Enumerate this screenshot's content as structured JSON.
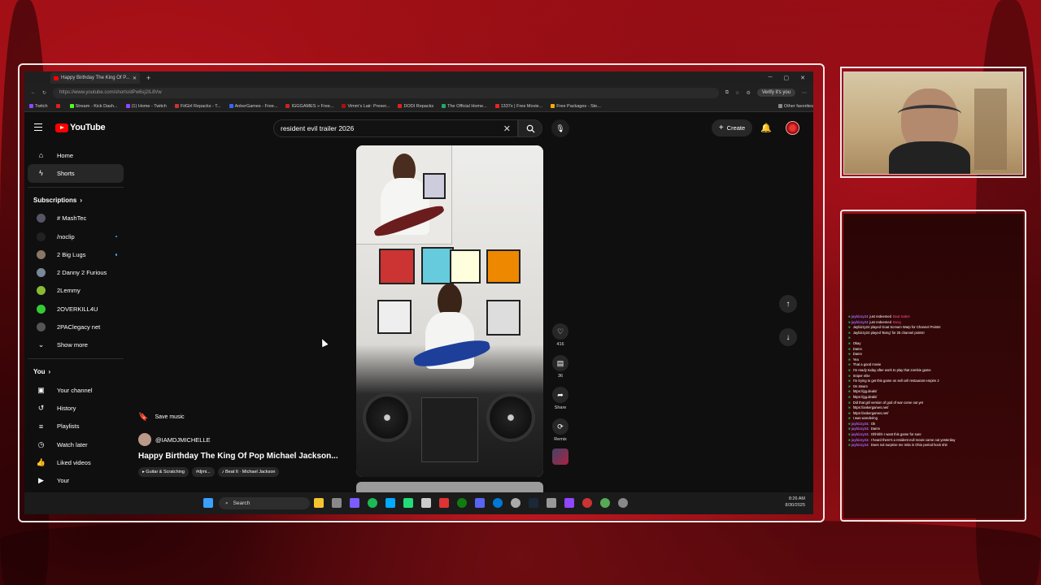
{
  "browser": {
    "tab_title": "Happy Birthday The King Of P...",
    "url": "https://www.youtube.com/shorts/dPw6sj2IL8Vw",
    "verify_label": "Verify it's you",
    "bookmarks": [
      {
        "label": "Twitch",
        "color": "#9146ff"
      },
      {
        "label": "",
        "color": "#e01f1f"
      },
      {
        "label": "Stream - Kick Dash...",
        "color": "#53fc18"
      },
      {
        "label": "(1) Home - Twitch",
        "color": "#9146ff"
      },
      {
        "label": "FitGirl Repacks - T...",
        "color": "#c33"
      },
      {
        "label": "AnkerGames - Free...",
        "color": "#36f"
      },
      {
        "label": "IGGGAMES » Free...",
        "color": "#c22"
      },
      {
        "label": "Vimm's Lair: Preser...",
        "color": "#a11"
      },
      {
        "label": "DODI Repacks",
        "color": "#d22"
      },
      {
        "label": "The Official Home...",
        "color": "#2a6"
      },
      {
        "label": "1337x | Free Movie...",
        "color": "#e22"
      },
      {
        "label": "Free Packages - Ste...",
        "color": "#fa0"
      },
      {
        "label": "Other favorites",
        "color": "#888"
      }
    ]
  },
  "youtube": {
    "logo_text": "YouTube",
    "search_value": "resident evil trailer 2026",
    "create_label": "Create",
    "sidebar": {
      "home": "Home",
      "shorts": "Shorts",
      "subscriptions_header": "Subscriptions",
      "subscriptions": [
        {
          "label": "# MashTec",
          "color": "#556",
          "dot": false
        },
        {
          "label": "/noclip",
          "color": "#222",
          "dot": true
        },
        {
          "label": "2 Big Lugs",
          "color": "#876",
          "dot": true
        },
        {
          "label": "2 Danny 2 Furious",
          "color": "#789",
          "dot": false
        },
        {
          "label": "2Lemmy",
          "color": "#8b3",
          "dot": false
        },
        {
          "label": "2OVERKILL4U",
          "color": "#3c3",
          "dot": false
        },
        {
          "label": "2PAClegacy net",
          "color": "#555",
          "dot": false
        }
      ],
      "show_more": "Show more",
      "you_header": "You",
      "you_items": [
        "Your channel",
        "History",
        "Playlists",
        "Watch later",
        "Liked videos",
        "Your"
      ]
    },
    "short": {
      "save_music": "Save music",
      "channel": "@IAMDJMICHELLE",
      "title": "Happy Birthday The King Of Pop Michael Jackson...",
      "tags": [
        "Guitar & Scratching",
        "#djmi...",
        "Beat It · Michael Jackson"
      ],
      "likes": "416",
      "comments": "36",
      "share_label": "Share",
      "remix_label": "Remix"
    }
  },
  "taskbar": {
    "search_placeholder": "Search",
    "time": "8:26 AM",
    "date": "8/30/2025"
  },
  "chat": {
    "lines": [
      {
        "user": "jaybizzy24",
        "text": "just redeemed",
        "ucolor": "#9b6bff",
        "tcolor": "#ff4fa0",
        "extra": "Beat Saber"
      },
      {
        "user": "jaybizzy24",
        "text": "just redeemed",
        "ucolor": "#9b6bff",
        "tcolor": "#ff4fa0",
        "extra": "Bong"
      },
      {
        "user": "",
        "text": "Jaybizzy24 played Goat Scream Warp for Channel Points!",
        "ucolor": "#9b6bff",
        "tcolor": "#fff",
        "extra": ""
      },
      {
        "user": "",
        "text": "Jaybizzy24 played 'Bong' for 25 channel points!",
        "ucolor": "#9b6bff",
        "tcolor": "#fff",
        "extra": ""
      },
      {
        "user": "",
        "text": "",
        "ucolor": "#9b6bff",
        "tcolor": "#fff",
        "extra": ""
      },
      {
        "user": "",
        "text": "Okay",
        "ucolor": "#9b6bff",
        "tcolor": "#fff",
        "extra": ""
      },
      {
        "user": "",
        "text": "Damn",
        "ucolor": "#9b6bff",
        "tcolor": "#fff",
        "extra": ""
      },
      {
        "user": "",
        "text": "Damn",
        "ucolor": "#9b6bff",
        "tcolor": "#fff",
        "extra": ""
      },
      {
        "user": "",
        "text": "Yea",
        "ucolor": "#9b6bff",
        "tcolor": "#fff",
        "extra": ""
      },
      {
        "user": "",
        "text": "That a good movie",
        "ucolor": "#9b6bff",
        "tcolor": "#fff",
        "extra": ""
      },
      {
        "user": "",
        "text": "I'm ready today after work to play that zombie game",
        "ucolor": "#9b6bff",
        "tcolor": "#fff",
        "extra": ""
      },
      {
        "user": "",
        "text": "Sniper elite",
        "ucolor": "#9b6bff",
        "tcolor": "#fff",
        "extra": ""
      },
      {
        "user": "",
        "text": "I'm trying to get this game on sell cell restaurant empire 2",
        "ucolor": "#9b6bff",
        "tcolor": "#fff",
        "extra": ""
      },
      {
        "user": "",
        "text": "On steam",
        "ucolor": "#9b6bff",
        "tcolor": "#fff",
        "extra": ""
      },
      {
        "user": "",
        "text": "https://gg.deals/",
        "ucolor": "#9b6bff",
        "tcolor": "#fff",
        "extra": ""
      },
      {
        "user": "",
        "text": "https://gg.deals/",
        "ucolor": "#9b6bff",
        "tcolor": "#fff",
        "extra": ""
      },
      {
        "user": "",
        "text": "Did that girl version of god of war come out yet",
        "ucolor": "#9b6bff",
        "tcolor": "#fff",
        "extra": ""
      },
      {
        "user": "",
        "text": "https://ankergames.net/",
        "ucolor": "#9b6bff",
        "tcolor": "#fff",
        "extra": ""
      },
      {
        "user": "",
        "text": "https://ankergames.net/",
        "ucolor": "#9b6bff",
        "tcolor": "#fff",
        "extra": ""
      },
      {
        "user": "",
        "text": "I was wondering",
        "ucolor": "#9b6bff",
        "tcolor": "#fff",
        "extra": ""
      },
      {
        "user": "jaybizzy24:",
        "text": "Ok",
        "ucolor": "#9b6bff",
        "tcolor": "#fff",
        "extra": ""
      },
      {
        "user": "jaybizzy24:",
        "text": "Damn",
        "ucolor": "#9b6bff",
        "tcolor": "#fff",
        "extra": ""
      },
      {
        "user": "jaybizzy24:",
        "text": "Ohhhhh I want this game for sure",
        "ucolor": "#9b6bff",
        "tcolor": "#fff",
        "extra": ""
      },
      {
        "user": "jaybizzy24:",
        "text": "I heard there's a resident evil movie came out yesterday",
        "ucolor": "#9b6bff",
        "tcolor": "#fff",
        "extra": ""
      },
      {
        "user": "jaybizzy24:",
        "text": "Does not surprise me mtla in Ohio period hock shit",
        "ucolor": "#9b6bff",
        "tcolor": "#fff",
        "extra": ""
      }
    ]
  }
}
